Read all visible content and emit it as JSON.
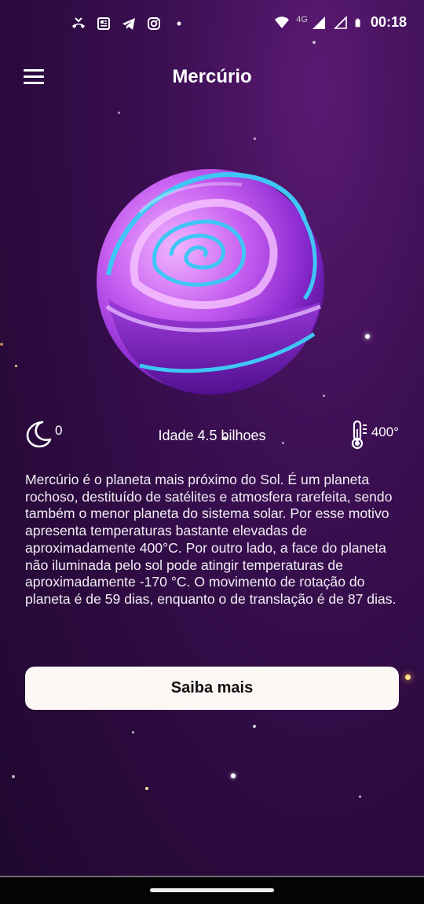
{
  "status_bar": {
    "time": "00:18",
    "network_label": "4G",
    "left_icons": [
      "missed-call-icon",
      "news-icon",
      "telegram-icon",
      "instagram-icon",
      "dot-icon"
    ],
    "right_icons": [
      "wifi-icon",
      "signal-icon",
      "signal-empty-icon",
      "battery-icon"
    ]
  },
  "header": {
    "title": "Mercúrio",
    "menu_icon": "hamburger-menu-icon"
  },
  "planet": {
    "name": "Mercúrio",
    "colors": {
      "main": "#b24ee8",
      "highlight": "#e7a6ff",
      "rim": "#3fc6f5",
      "shadow": "#6b1fb0"
    }
  },
  "stats": {
    "moons": "0",
    "moons_icon": "moon-icon",
    "age": "Idade 4.5 bilhoes",
    "temperature": "400°",
    "temperature_icon": "thermometer-icon"
  },
  "description": "Mercúrio é o planeta mais próximo do Sol. É um planeta rochoso, destituído de satélites e atmosfera rarefeita, sendo também o menor planeta do sistema solar. Por esse motivo apresenta temperaturas bastante elevadas de aproximadamente 400°C. Por outro lado, a face do planeta não iluminada pelo sol pode atingir temperaturas de aproximadamente -170 °C. O movimento de rotação do planeta é de 59 dias, enquanto o de translação é de 87 dias.",
  "button": {
    "label": "Saiba mais"
  }
}
